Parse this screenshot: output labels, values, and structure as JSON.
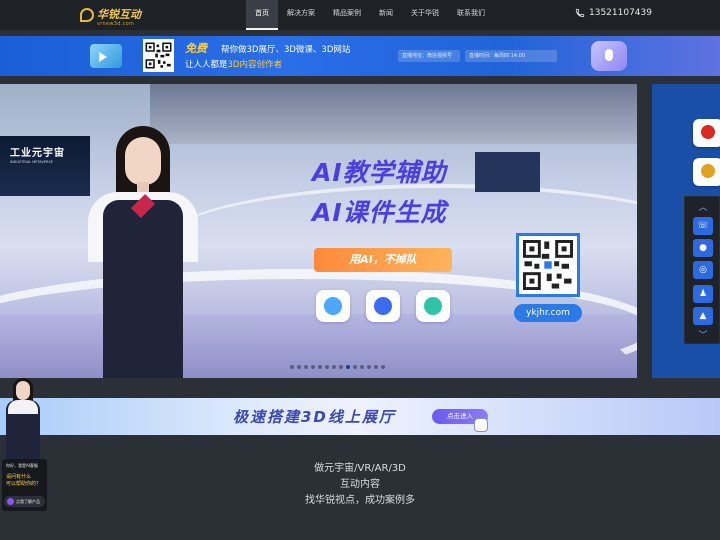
{
  "brand": {
    "name": "华锐互动",
    "domain": "vrnew3d.com"
  },
  "nav": {
    "items": [
      {
        "label": "首页",
        "active": true
      },
      {
        "label": "解决方案",
        "active": false
      },
      {
        "label": "精品案例",
        "active": false
      },
      {
        "label": "新闻",
        "active": false
      },
      {
        "label": "关于华锐",
        "active": false
      },
      {
        "label": "联系我们",
        "active": false
      }
    ],
    "phone": "13521107439"
  },
  "ad": {
    "free": "免费",
    "line1": "帮你做3D展厅、3D微课、3D网站",
    "line2_prefix": "让人人都是",
    "line2_highlight": "3D内容创作者",
    "live_label": "直播地址：微信视频号",
    "time_label": "直播时间：每周四 14:00"
  },
  "hero": {
    "title1": "AI教学辅助",
    "title2": "AI课件生成",
    "pill": "用AI，不掉队",
    "url": "ykjhr.com",
    "screen_title": "工业元宇宙",
    "screen_sub": "INDUSTRIAL METAVERSE",
    "slide_count": 14,
    "active_slide": 8
  },
  "banner2": {
    "text": "极速搭建3D线上展厅",
    "button": "点击进入"
  },
  "bottom": {
    "line1": "做元宇宙/VR/AR/3D",
    "line2": "互动内容",
    "line3": "找华锐视点，成功案例多"
  },
  "chat": {
    "hello": "你好，我是AI客服",
    "question1": "请问有什么",
    "question2": "可以帮助你的？",
    "button": "点我了解产品"
  },
  "colors": {
    "nav_bg": "#1e2126",
    "accent_blue": "#2a7be8",
    "hero_title": "#4a3fe0",
    "pill_orange": "#ff8a3c",
    "ad_yellow": "#ffcd3c"
  }
}
